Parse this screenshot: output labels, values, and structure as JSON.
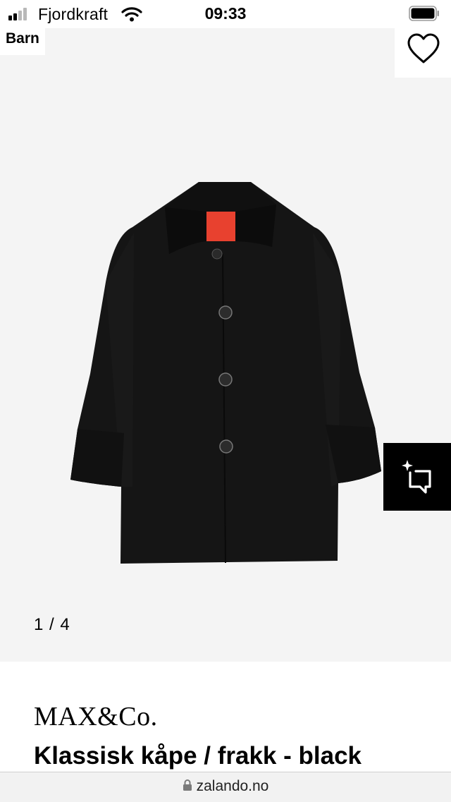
{
  "status_bar": {
    "carrier": "Fjordkraft",
    "time": "09:33",
    "signal_bars_filled": 2,
    "signal_bars_total": 4,
    "battery_level": 1.0,
    "icons": [
      "signal-icon",
      "wifi-icon",
      "battery-icon"
    ]
  },
  "gallery": {
    "category_tag": "Barn",
    "image_counter": "1 / 4",
    "wishlist_icon": "heart-icon",
    "similar_items_icon": "sparkle-crop-icon",
    "background_color": "#f4f4f4"
  },
  "product": {
    "brand": "MAX&Co.",
    "name": "Klassisk kåpe / frakk - black",
    "color": "#141414",
    "lining_color": "#e8412f"
  },
  "browser": {
    "url": "zalando.no",
    "url_icon": "lock-icon"
  }
}
